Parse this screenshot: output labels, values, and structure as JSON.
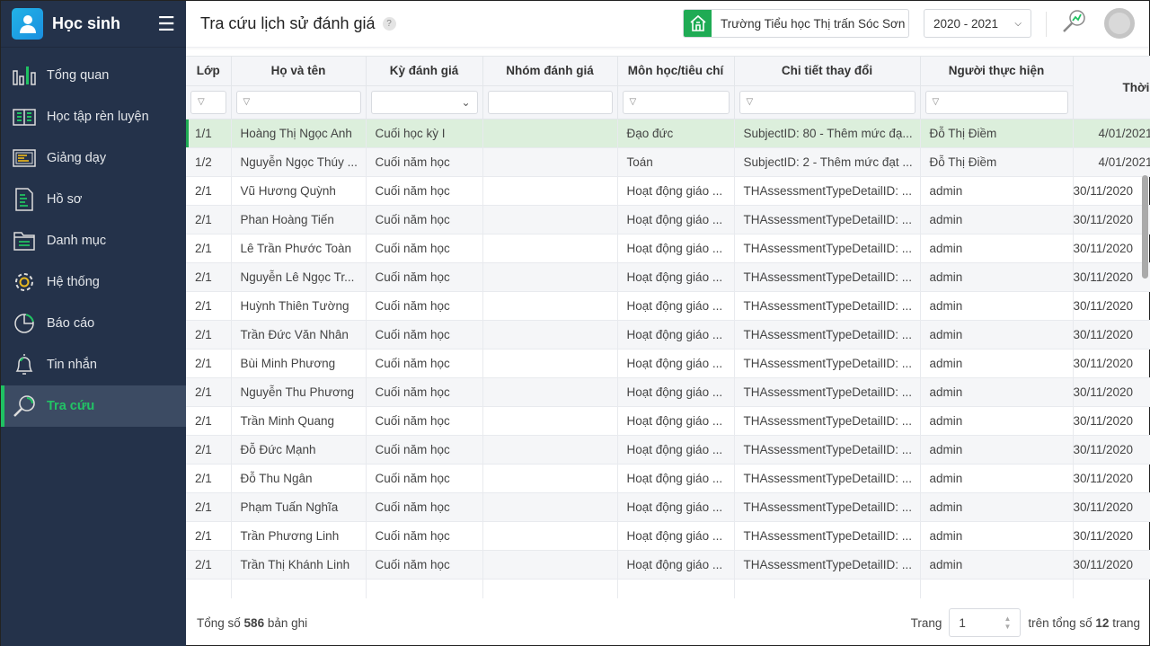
{
  "sidebar": {
    "title": "Học sinh",
    "items": [
      {
        "label": "Tổng quan",
        "icon": "bar-chart-icon"
      },
      {
        "label": "Học tập rèn luyện",
        "icon": "book-icon"
      },
      {
        "label": "Giảng dạy",
        "icon": "board-icon"
      },
      {
        "label": "Hồ sơ",
        "icon": "document-icon"
      },
      {
        "label": "Danh mục",
        "icon": "folder-icon"
      },
      {
        "label": "Hệ thống",
        "icon": "gear-icon"
      },
      {
        "label": "Báo cáo",
        "icon": "pie-chart-icon"
      },
      {
        "label": "Tin nhắn",
        "icon": "bell-icon"
      },
      {
        "label": "Tra cứu",
        "icon": "search-icon",
        "active": true
      }
    ]
  },
  "header": {
    "title": "Tra cứu lịch sử đánh giá",
    "help": "?",
    "school": "Trường Tiểu học Thị trấn Sóc Sơn",
    "year": "2020 - 2021"
  },
  "table": {
    "columns": [
      "Lớp",
      "Họ và tên",
      "Kỳ đánh giá",
      "Nhóm đánh giá",
      "Môn học/tiêu chí",
      "Chi tiết thay đổi",
      "Người thực hiện",
      "Thời"
    ],
    "rows": [
      [
        "1/1",
        "Hoàng Thị Ngọc Anh",
        "Cuối học kỳ I",
        "",
        "Đạo đức",
        "SubjectID: 80 - Thêm mức đạ...",
        "Đỗ Thị Điềm",
        "4/01/2021"
      ],
      [
        "1/2",
        "Nguyễn Ngọc Thúy ...",
        "Cuối năm học",
        "",
        "Toán",
        "SubjectID: 2 - Thêm mức đạt ...",
        "Đỗ Thị Điềm",
        "4/01/2021"
      ],
      [
        "2/1",
        "Vũ Hương Quỳnh",
        "Cuối năm học",
        "",
        "Hoạt động giáo ...",
        "THAssessmentTypeDetailID: ...",
        "admin",
        "30/11/2020"
      ],
      [
        "2/1",
        "Phan Hoàng Tiến",
        "Cuối năm học",
        "",
        "Hoạt động giáo ...",
        "THAssessmentTypeDetailID: ...",
        "admin",
        "30/11/2020"
      ],
      [
        "2/1",
        "Lê Trần Phước Toàn",
        "Cuối năm học",
        "",
        "Hoạt động giáo ...",
        "THAssessmentTypeDetailID: ...",
        "admin",
        "30/11/2020"
      ],
      [
        "2/1",
        "Nguyễn Lê Ngọc Tr...",
        "Cuối năm học",
        "",
        "Hoạt động giáo ...",
        "THAssessmentTypeDetailID: ...",
        "admin",
        "30/11/2020"
      ],
      [
        "2/1",
        "Huỳnh Thiên Tường",
        "Cuối năm học",
        "",
        "Hoạt động giáo ...",
        "THAssessmentTypeDetailID: ...",
        "admin",
        "30/11/2020"
      ],
      [
        "2/1",
        "Trần Đức Văn Nhân",
        "Cuối năm học",
        "",
        "Hoạt động giáo ...",
        "THAssessmentTypeDetailID: ...",
        "admin",
        "30/11/2020"
      ],
      [
        "2/1",
        "Bùi Minh Phương",
        "Cuối năm học",
        "",
        "Hoạt động giáo ...",
        "THAssessmentTypeDetailID: ...",
        "admin",
        "30/11/2020"
      ],
      [
        "2/1",
        "Nguyễn Thu Phương",
        "Cuối năm học",
        "",
        "Hoạt động giáo ...",
        "THAssessmentTypeDetailID: ...",
        "admin",
        "30/11/2020"
      ],
      [
        "2/1",
        "Trần Minh Quang",
        "Cuối năm học",
        "",
        "Hoạt động giáo ...",
        "THAssessmentTypeDetailID: ...",
        "admin",
        "30/11/2020"
      ],
      [
        "2/1",
        "Đỗ Đức Mạnh",
        "Cuối năm học",
        "",
        "Hoạt động giáo ...",
        "THAssessmentTypeDetailID: ...",
        "admin",
        "30/11/2020"
      ],
      [
        "2/1",
        "Đỗ Thu Ngân",
        "Cuối năm học",
        "",
        "Hoạt động giáo ...",
        "THAssessmentTypeDetailID: ...",
        "admin",
        "30/11/2020"
      ],
      [
        "2/1",
        "Phạm Tuấn Nghĩa",
        "Cuối năm học",
        "",
        "Hoạt động giáo ...",
        "THAssessmentTypeDetailID: ...",
        "admin",
        "30/11/2020"
      ],
      [
        "2/1",
        "Trần Phương Linh",
        "Cuối năm học",
        "",
        "Hoạt động giáo ...",
        "THAssessmentTypeDetailID: ...",
        "admin",
        "30/11/2020"
      ],
      [
        "2/1",
        "Trần Thị Khánh Linh",
        "Cuối năm học",
        "",
        "Hoạt động giáo ...",
        "THAssessmentTypeDetailID: ...",
        "admin",
        "30/11/2020"
      ]
    ]
  },
  "footer": {
    "total_prefix": "Tổng số",
    "total": "586",
    "total_suffix": "bản ghi",
    "page_label": "Trang",
    "page": "1",
    "pages_prefix": "trên tổng số",
    "pages": "12",
    "pages_suffix": "trang"
  },
  "colors": {
    "accent": "#1fab54",
    "sidebar": "#24324a"
  }
}
